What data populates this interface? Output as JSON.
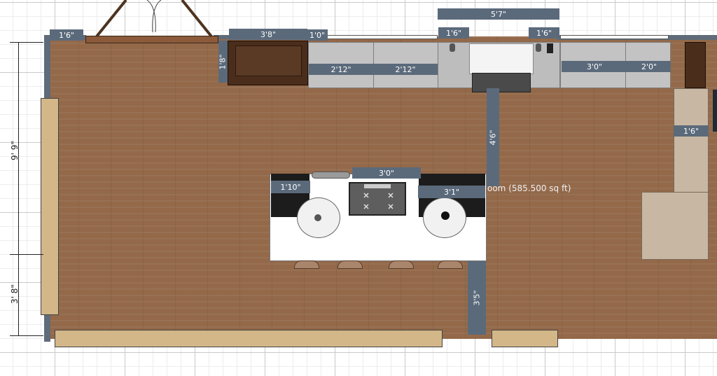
{
  "room_label": "oom (585.500 sq ft)",
  "dimensions": {
    "d1": "1'6\"",
    "d2": "3'8\"",
    "d3": "1'0\"",
    "d4": "5'7\"",
    "d5": "1'6\"",
    "d6": "1'6\"",
    "d7": "1'8\"",
    "d8": "2'12\"",
    "d9": "2'12\"",
    "d10": "3'0\"",
    "d11": "2'0\"",
    "d12": "4'6\"",
    "d13": "1'6\"",
    "d14": "3'0\"",
    "d15": "1'10\"",
    "d16": "3'1\"",
    "d17": "3'5\""
  },
  "ruler": {
    "left_top": "9' 9\"",
    "left_bottom": "3' 8\""
  },
  "colors": {
    "floor": "#93694a",
    "wall": "#5f6b79",
    "dimension_badge": "#5b6a7b",
    "counter": "#c3c3c3",
    "island": "#ffffff"
  }
}
